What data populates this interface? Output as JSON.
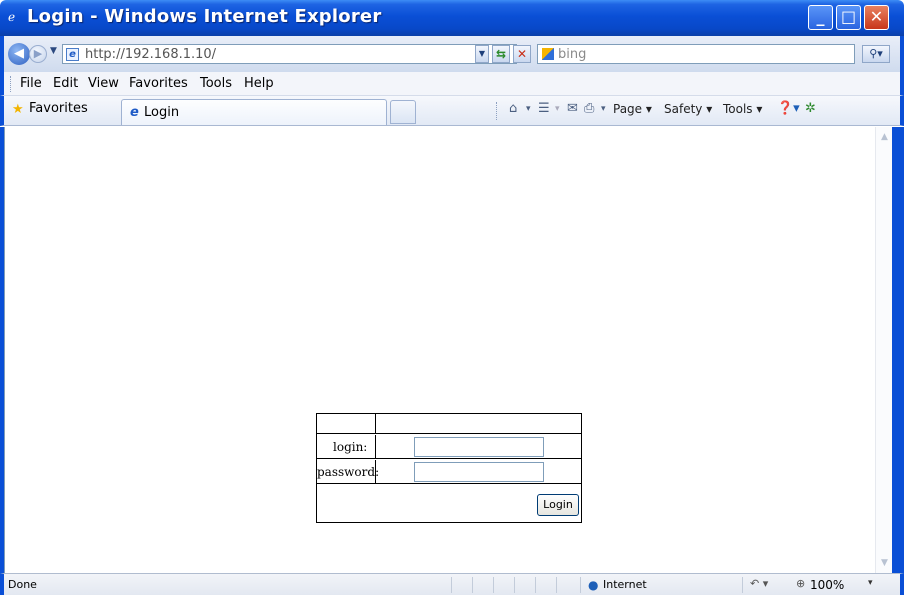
{
  "window": {
    "title": "Login - Windows Internet Explorer",
    "buttons": {
      "minimize": "_",
      "maximize": "□",
      "close": "✕"
    }
  },
  "address": {
    "url": "http://192.168.1.10/",
    "search_placeholder": "bing"
  },
  "menu": {
    "items": [
      "File",
      "Edit",
      "View",
      "Favorites",
      "Tools",
      "Help"
    ],
    "underlined": [
      "F",
      "E",
      "V",
      "a",
      "T",
      "H"
    ]
  },
  "favbar": {
    "favorites_label": "Favorites",
    "tab_label": "Login",
    "commands": [
      "Page",
      "Safety",
      "Tools"
    ]
  },
  "form": {
    "login_label": "login:",
    "password_label": "password:",
    "login_value": "",
    "password_value": "",
    "submit_label": "Login"
  },
  "status": {
    "text": "Done",
    "zone": "Internet",
    "zoom": "100%"
  },
  "colors": {
    "titlebar": "#0a4fd6",
    "frame": "#0a4fd6"
  }
}
